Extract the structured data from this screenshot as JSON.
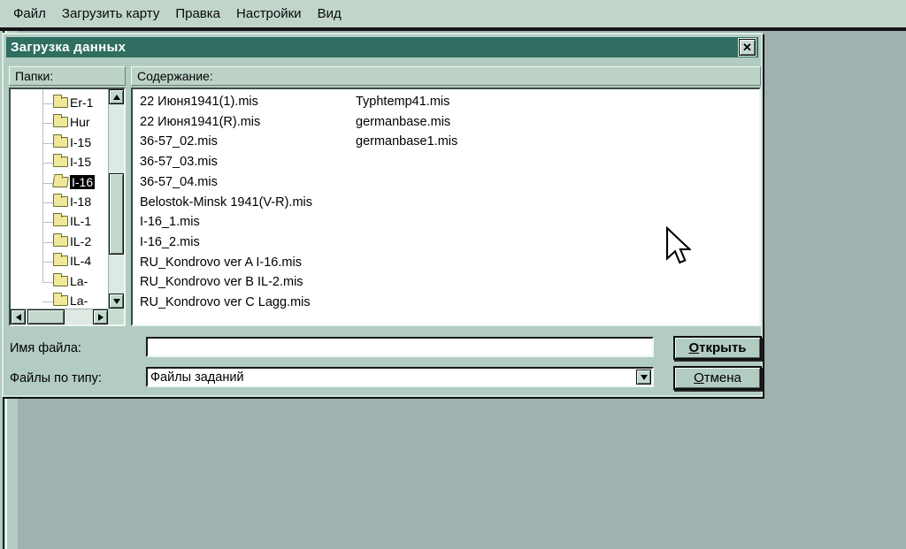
{
  "menu": {
    "items": [
      "Файл",
      "Загрузить карту",
      "Правка",
      "Настройки",
      "Вид"
    ]
  },
  "dialog": {
    "title": "Загрузка данных",
    "close_label": "x",
    "folders_header": "Папки:",
    "contents_header": "Содержание:",
    "tree": {
      "items": [
        {
          "label": "Er-1",
          "selected": false
        },
        {
          "label": "Hur",
          "selected": false
        },
        {
          "label": "I-15",
          "selected": false
        },
        {
          "label": "I-15",
          "selected": false
        },
        {
          "label": "I-16",
          "selected": true
        },
        {
          "label": "I-18",
          "selected": false
        },
        {
          "label": "IL-1",
          "selected": false
        },
        {
          "label": "IL-2",
          "selected": false
        },
        {
          "label": "IL-4",
          "selected": false
        },
        {
          "label": "La-",
          "selected": false
        },
        {
          "label": "La-",
          "selected": false
        }
      ]
    },
    "files": {
      "column1": [
        "22 Июня1941(1).mis",
        "22 Июня1941(R).mis",
        "36-57_02.mis",
        "36-57_03.mis",
        "36-57_04.mis",
        "Belostok-Minsk 1941(V-R).mis",
        "I-16_1.mis",
        "I-16_2.mis",
        "RU_Kondrovo ver A I-16.mis",
        "RU_Kondrovo ver B IL-2.mis",
        "RU_Kondrovo ver C Lagg.mis"
      ],
      "column2": [
        "Typhtemp41.mis",
        "germanbase.mis",
        "germanbase1.mis"
      ]
    },
    "filename_label": "Имя файла:",
    "filename_value": "",
    "filetype_label": "Файлы по типу:",
    "filetype_value": "Файлы заданий",
    "open_button": "Открыть",
    "cancel_button": "Отмена"
  },
  "colors": {
    "menubar_bg": "#c1d5cb",
    "dialog_bg": "#b3ccc1",
    "titlebar_bg": "#2f6e60",
    "titlebar_text": "#ffffff",
    "workspace_bg": "#9fb1b0",
    "selection_bg": "#000000",
    "selection_text": "#ffffff",
    "folder_yellow": "#efe79a"
  }
}
